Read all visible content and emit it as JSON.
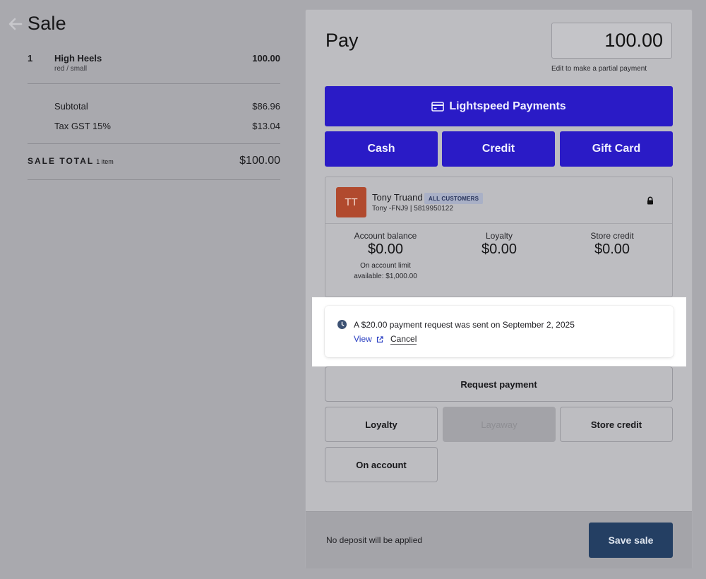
{
  "sale": {
    "title": "Sale",
    "back_icon": "arrow-left-icon",
    "line_items": [
      {
        "qty": "1",
        "name": "High Heels",
        "variant": "red / small",
        "price": "100.00"
      }
    ],
    "subtotal_label": "Subtotal",
    "subtotal_value": "$86.96",
    "tax_label": "Tax GST 15%",
    "tax_value": "$13.04",
    "total_label": "SALE TOTAL",
    "total_count": "1 item",
    "total_value": "$100.00"
  },
  "pay": {
    "title": "Pay",
    "amount": "100.00",
    "amount_hint": "Edit to make a partial payment",
    "methods": {
      "lightspeed": "Lightspeed Payments",
      "lightspeed_icon": "credit-card-icon",
      "cash": "Cash",
      "credit": "Credit",
      "gift_card": "Gift Card"
    },
    "customer": {
      "initials": "TT",
      "name": "Tony Truand",
      "group_badge": "ALL CUSTOMERS",
      "sub": "Tony -FNJ9 | 5819950122",
      "lock_icon": "lock-icon",
      "account_balance_label": "Account balance",
      "account_balance_value": "$0.00",
      "account_limit_note_1": "On account limit",
      "account_limit_note_2": "available: $1,000.00",
      "loyalty_label": "Loyalty",
      "loyalty_value": "$0.00",
      "store_credit_label": "Store credit",
      "store_credit_value": "$0.00"
    },
    "notice": {
      "icon": "clock-icon",
      "text": "A $20.00 payment request was sent on September 2, 2025",
      "view_label": "View",
      "cancel_label": "Cancel"
    },
    "secondary": {
      "request_payment": "Request payment",
      "loyalty": "Loyalty",
      "layaway": "Layaway",
      "store_credit": "Store credit",
      "on_account": "On account"
    },
    "footer": {
      "note": "No deposit will be applied",
      "save_label": "Save sale"
    }
  },
  "colors": {
    "primary_button": "#2a1bc6",
    "save_button": "#243f63",
    "avatar": "#b14a2e",
    "link": "#2a3fc2"
  }
}
